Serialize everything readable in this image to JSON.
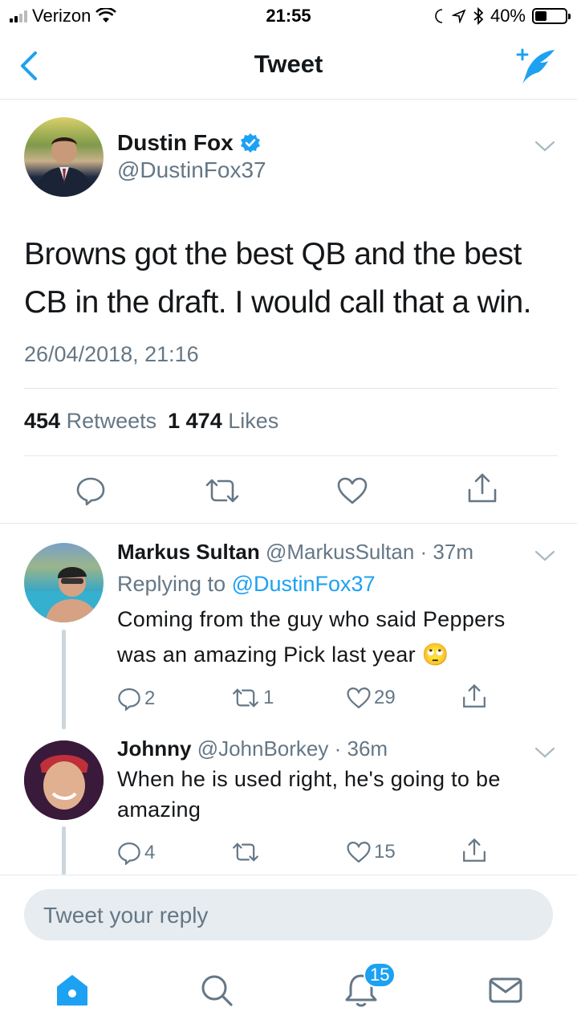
{
  "status_bar": {
    "carrier": "Verizon",
    "time": "21:55",
    "battery": "40%",
    "battery_level": 0.4
  },
  "nav": {
    "title": "Tweet"
  },
  "tweet": {
    "author_name": "Dustin Fox",
    "author_handle": "@DustinFox37",
    "text": "Browns got the best QB and the best CB in the draft. I would call that a win.",
    "date": "26/04/2018, 21:16",
    "retweets_count": "454",
    "retweets_label": "Retweets",
    "likes_count": "1 474",
    "likes_label": "Likes"
  },
  "replies": [
    {
      "name": "Markus Sultan",
      "handle": "@MarkusSultan",
      "time": "· 37m",
      "replying_prefix": "Replying to",
      "replying_to": "@DustinFox37",
      "text": "Coming from the guy who said Peppers was an amazing Pick last year 🙄",
      "reply_count": "2",
      "retweet_count": "1",
      "like_count": "29"
    },
    {
      "name": "Johnny",
      "handle": "@JohnBorkey",
      "time": "· 36m",
      "text": "When he is used right, he's going to be amazing",
      "reply_count": "4",
      "retweet_count": "",
      "like_count": "15"
    }
  ],
  "composer": {
    "placeholder": "Tweet your reply"
  },
  "tabbar": {
    "notifications_badge": "15"
  },
  "colors": {
    "accent": "#1da1f2",
    "text": "#14171a",
    "muted": "#657786",
    "divider": "#e1e8ed"
  }
}
